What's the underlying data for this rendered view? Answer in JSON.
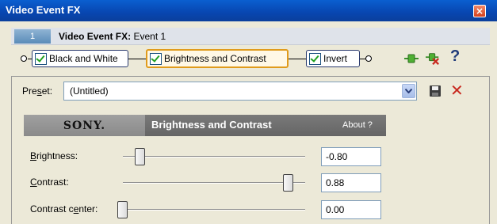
{
  "window": {
    "title": "Video Event FX",
    "close_label": "×"
  },
  "event": {
    "number": "1",
    "label_prefix": "Video Event FX:",
    "label_name": "Event 1"
  },
  "chain": {
    "plugins": [
      {
        "label": "Black and White",
        "checked": true
      },
      {
        "label": "Brightness and Contrast",
        "checked": true,
        "selected": true
      },
      {
        "label": "Invert",
        "checked": true
      }
    ],
    "toolbar": {
      "add_icon": "plug-chain-add-icon",
      "remove_icon": "plug-remove-icon",
      "help_label": "?"
    }
  },
  "preset": {
    "label_pre": "Pre",
    "label_mn": "s",
    "label_post": "et:",
    "value": "(Untitled)",
    "delete_label": "✕"
  },
  "plugin_header": {
    "brand": "SONY.",
    "title": "Brightness and Contrast",
    "about": "About  ?"
  },
  "params": [
    {
      "label_mn": "B",
      "label_rest": "rightness:",
      "value": "-0.80",
      "level": 0.1
    },
    {
      "label_mn": "C",
      "label_rest": "ontrast:",
      "value": "0.88",
      "level": 0.94
    },
    {
      "label_pre": "Contrast c",
      "label_mn": "e",
      "label_rest": "nter:",
      "value": "0.00",
      "level": 0.0
    }
  ],
  "colors": {
    "title_bar": "#0846b0",
    "selected_plugin_border": "#e09b1c",
    "delete_red": "#c8281e",
    "check_green": "#21a121"
  }
}
